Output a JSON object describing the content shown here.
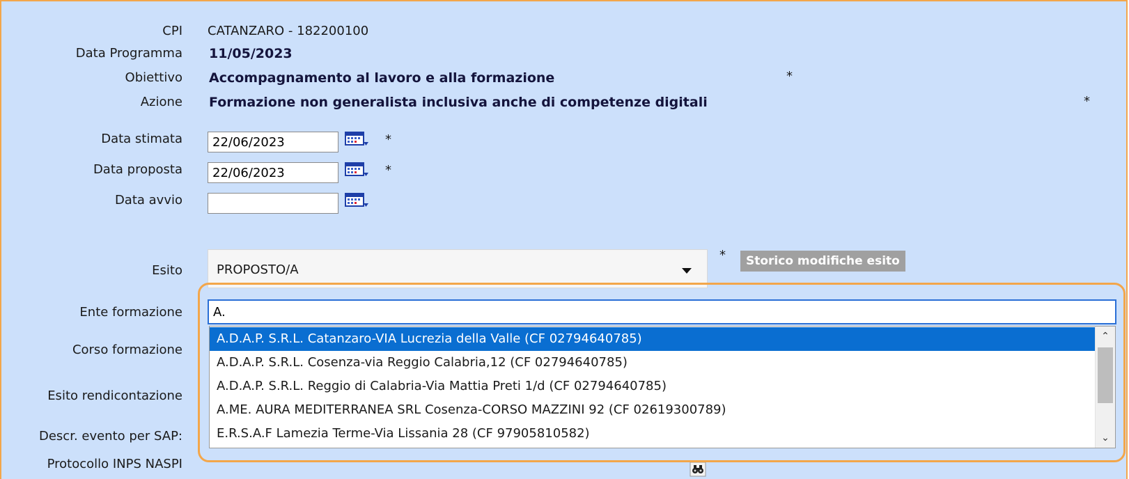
{
  "form": {
    "cpi": {
      "label": "CPI",
      "value": "CATANZARO - 182200100"
    },
    "data_programma": {
      "label": "Data Programma",
      "value": "11/05/2023"
    },
    "obiettivo": {
      "label": "Obiettivo",
      "value": "Accompagnamento al lavoro e alla formazione",
      "required": "*"
    },
    "azione": {
      "label": "Azione",
      "value": "Formazione non generalista inclusiva anche di competenze digitali",
      "required": "*"
    },
    "data_stimata": {
      "label": "Data stimata",
      "value": "22/06/2023",
      "required": "*",
      "icon": "calendar-icon"
    },
    "data_proposta": {
      "label": "Data proposta",
      "value": "22/06/2023",
      "required": "*",
      "icon": "calendar-icon"
    },
    "data_avvio": {
      "label": "Data avvio",
      "value": "",
      "icon": "calendar-icon"
    },
    "esito": {
      "label": "Esito",
      "value": "PROPOSTO/A",
      "required": "*",
      "storico_button": "Storico modifiche esito"
    },
    "ente_formazione": {
      "label": "Ente formazione",
      "value": "A."
    },
    "corso_formazione": {
      "label": "Corso formazione"
    },
    "esito_rendicontazione": {
      "label": "Esito rendicontazione"
    },
    "descr_evento": {
      "label": "Descr. evento per SAP:"
    },
    "protocollo_inps": {
      "label": "Protocollo INPS NASPI",
      "icon": "binoculars-icon"
    }
  },
  "dropdown": {
    "options": [
      "A.D.A.P. S.R.L. Catanzaro-VIA Lucrezia della Valle (CF 02794640785)",
      "A.D.A.P. S.R.L. Cosenza-via Reggio Calabria,12 (CF 02794640785)",
      "A.D.A.P. S.R.L. Reggio di Calabria-Via Mattia Preti 1/d (CF 02794640785)",
      "A.ME. AURA MEDITERRANEA SRL Cosenza-CORSO MAZZINI 92 (CF 02619300789)",
      "E.R.S.A.F Lamezia Terme-Via Lissania 28 (CF 97905810582)"
    ],
    "selected_index": 0
  },
  "colors": {
    "panel_bg": "#cce0fb",
    "highlight_border": "#f3a64a",
    "selected_option": "#0a6ed1",
    "storico_button_bg": "#a0a0a0"
  }
}
